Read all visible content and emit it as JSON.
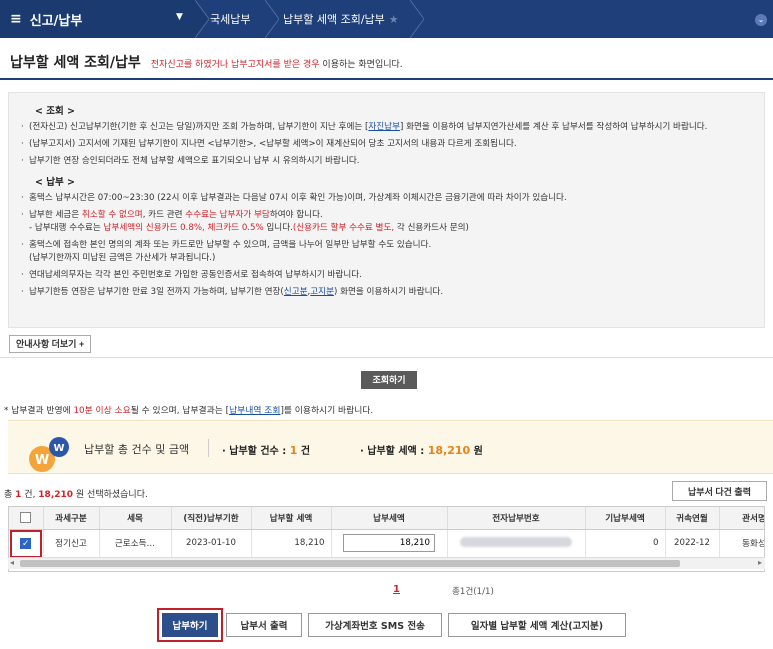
{
  "topbar": {
    "menu_label": "신고/납부",
    "crumb1": "국세납부",
    "crumb2": "납부할 세액 조회/납부"
  },
  "header": {
    "title": "납부할 세액 조회/납부",
    "note_red": "전자신고를 하였거나 납부고지서를 받은 경우",
    "note_rest": " 이용하는 화면입니다."
  },
  "notice": {
    "section1": "< 조회 >",
    "s1_item1_a": "(전자신고) 신고납부기한(기한 후 신고는 당일)까지만 조회 가능하며, 납부기한이 지난 후에는 [",
    "s1_item1_link": "자진납부",
    "s1_item1_b": "] 화면을 이용하여 납부지연가산세를 계산 후 납부서를 작성하여 납부하시기 바랍니다.",
    "s1_item2": "(납부고지서) 고지서에 기재된 납부기한이 지나면 <납부기한>, <납부할 세액>이 재계산되어 당초 고지서의 내용과 다르게 조회됩니다.",
    "s1_item3": "납부기한 연장 승인되더라도 전체 납부할 세액으로 표기되오니 납부 시 유의하시기 바랍니다.",
    "section2": "< 납부 >",
    "s2_item1": "홈택스 납부시간은 07:00~23:30 (22시 이후 납부결과는 다음날 07시 이후 확인 가능)이며, 가상계좌 이체시간은 금융기관에 따라 차이가 있습니다.",
    "s2_item2_a": "납부한 세금은 ",
    "s2_item2_red1": "취소할 수 없으며",
    "s2_item2_b": ", 카드 관련 ",
    "s2_item2_red2": "수수료는 납부자가 부담",
    "s2_item2_c": "하여야 합니다.",
    "s2_item2_sub_a": "- 납부대행 수수료는 ",
    "s2_item2_sub_red1": "납부세액의 신용카드 0.8%, 체크카드 0.5%",
    "s2_item2_sub_b": " 입니다.",
    "s2_item2_sub_red2": "(신용카드 할부 수수료 별도,",
    "s2_item2_sub_c": " 각 신용카드사 문의)",
    "s2_item3_a": "홈택스에 접속한 본인 명의의 계좌 또는 카드로만 납부할 수 있으며, 금액을 나누어 일부만 납부할 수도 있습니다.",
    "s2_item3_b": "(납부기한까지 미납된 금액은 가산세가 부과됩니다.)",
    "s2_item4": "연대납세의무자는 각각 본인 주민번호로 가입한 공동인증서로 접속하여 납부하시기 바랍니다.",
    "s2_item5_a": "납부기한등 연장은 납부기한 만료 3일 전까지 가능하며, 납부기한 연장(",
    "s2_item5_link1": "신고분",
    "s2_item5_comma": ",",
    "s2_item5_link2": "고지분",
    "s2_item5_b": ") 화면을 이용하시기 바랍니다."
  },
  "more_button": "안내사항 더보기 +",
  "search_button": "조회하기",
  "info_line": {
    "a": "* 납부결과 반영에 ",
    "red": "10분 이상 소요",
    "b": "될 수 있으며, 납부결과는 [",
    "link": "납부내역 조회",
    "c": "]를 이용하시기 바랍니다."
  },
  "summary": {
    "label": "납부할 총 건수 및 금액",
    "count_label": "· 납부할 건수 : ",
    "count_value": "1",
    "count_unit": " 건",
    "amount_label": "· 납부할 세액 : ",
    "amount_value": "18,210",
    "amount_unit": " 원"
  },
  "selection": {
    "a": "총 ",
    "count": "1",
    "b": " 건, ",
    "amount": "18,210",
    "c": " 원 선택하셨습니다."
  },
  "print_multi_button": "납부서 다건 출력",
  "table": {
    "headers": [
      "과세구분",
      "세목",
      "(직전)납부기한",
      "납부할 세액",
      "납부세액",
      "전자납부번호",
      "기납부세액",
      "귀속연월",
      "관서명"
    ],
    "row": {
      "type": "정기신고",
      "tax_item": "근로소득…",
      "due_date": "2023-01-10",
      "amount_due": "18,210",
      "pay_amount": "18,210",
      "prepaid": "0",
      "period": "2022-12",
      "office": "동화성"
    }
  },
  "pager": {
    "current": "1",
    "total": "총1건(1/1)"
  },
  "buttons": {
    "pay": "납부하기",
    "print": "납부서 출력",
    "sms": "가상계좌번호 SMS 전송",
    "daily": "일자별 납부할 세액 계산(고지분)"
  },
  "colors": {
    "navy": "#1f3f7a",
    "accent_red": "#d2232a",
    "highlight_orange": "#e8821b"
  }
}
